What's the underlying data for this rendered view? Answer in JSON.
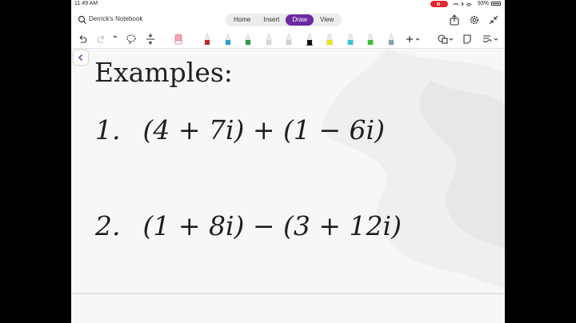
{
  "status_bar": {
    "time": "11:49 AM",
    "battery": "93%"
  },
  "top_bar": {
    "notebook_title": "Derrick's Notebook",
    "tabs": [
      {
        "label": "Home"
      },
      {
        "label": "Insert"
      },
      {
        "label": "Draw",
        "active": true
      },
      {
        "label": "View"
      }
    ],
    "accent_color": "#6b2aa0"
  },
  "toolbar": {
    "tools": [
      "undo-icon",
      "redo-icon",
      "lasso-select-icon",
      "add-space-icon",
      "eraser-icon"
    ],
    "pens": [
      {
        "kind": "pen",
        "color": "#c0282e"
      },
      {
        "kind": "pen",
        "color": "#2aa0d0"
      },
      {
        "kind": "pen",
        "color": "#2a9a4a"
      },
      {
        "kind": "pen",
        "color": "#d8d8d8"
      },
      {
        "kind": "pen",
        "color": "#cfcfcf"
      },
      {
        "kind": "pen",
        "color": "#111111",
        "selected": true
      },
      {
        "kind": "highlighter",
        "color": "#e8e800"
      },
      {
        "kind": "highlighter",
        "color": "#30c8e0"
      },
      {
        "kind": "highlighter",
        "color": "#38c038"
      },
      {
        "kind": "pen",
        "color": "#8aa0a8"
      }
    ]
  },
  "page": {
    "heading": "Examples:",
    "problems": [
      {
        "number": "1.",
        "expression": "(4 + 7i) + (1 − 6i)"
      },
      {
        "number": "2.",
        "expression": "(1 + 8i) − (3 + 12i)"
      }
    ]
  }
}
